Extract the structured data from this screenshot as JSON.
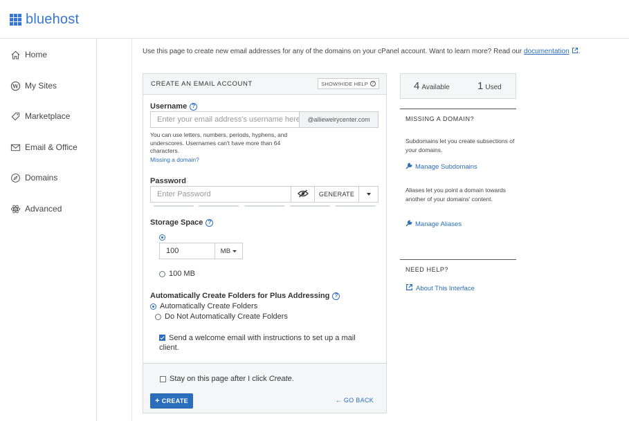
{
  "brand": {
    "name": "bluehost",
    "accent": "#3575d3",
    "link_color": "#2a6ebb"
  },
  "sidebar": {
    "items": [
      {
        "label": "Home",
        "icon": "home-icon"
      },
      {
        "label": "My Sites",
        "icon": "wordpress-icon"
      },
      {
        "label": "Marketplace",
        "icon": "tag-icon"
      },
      {
        "label": "Email & Office",
        "icon": "envelope-icon"
      },
      {
        "label": "Domains",
        "icon": "compass-icon"
      },
      {
        "label": "Advanced",
        "icon": "atom-icon"
      }
    ]
  },
  "intro": {
    "text": "Use this page to create new email addresses for any of the domains on your cPanel account. Want to learn more? Read our ",
    "link": "documentation",
    "end": "."
  },
  "form": {
    "title": "CREATE AN EMAIL ACCOUNT",
    "help_toggle": "SHOW/HIDE HELP",
    "username": {
      "label": "Username",
      "placeholder": "Enter your email address's username here.",
      "domain": "@alliewelrycenter.com",
      "hint": "You can use letters, numbers, periods, hyphens, and underscores. Usernames can't have more than 64 characters.",
      "missing_link": "Missing a domain?"
    },
    "password": {
      "label": "Password",
      "placeholder": "Enter Password",
      "generate": "GENERATE"
    },
    "storage": {
      "label": "Storage Space",
      "value": "100",
      "unit": "MB",
      "option_fixed": "100 MB"
    },
    "folders": {
      "label": "Automatically Create Folders for Plus Addressing",
      "opt_auto": "Automatically Create Folders",
      "opt_none": "Do Not Automatically Create Folders"
    },
    "welcome": {
      "line1": "Send a welcome email with instructions to set up a mail",
      "line2": "client.",
      "checked": true
    },
    "stay": {
      "text": "Stay on this page after I click ",
      "emph": "Create",
      "end": ".",
      "checked": false
    },
    "create_label": "CREATE",
    "back_label": "GO BACK"
  },
  "stats": {
    "available_n": "4",
    "available_label": "Available",
    "used_n": "1",
    "used_label": "Used"
  },
  "missing_domain": {
    "title": "MISSING A DOMAIN?",
    "sub_text": "Subdomains let you create subsections of your domains.",
    "sub_link": "Manage Subdomains",
    "alias_text": "Aliases let you point a domain towards another of your domains' content.",
    "alias_link": "Manage Aliases"
  },
  "need_help": {
    "title": "NEED HELP?",
    "link": "About This Interface"
  }
}
